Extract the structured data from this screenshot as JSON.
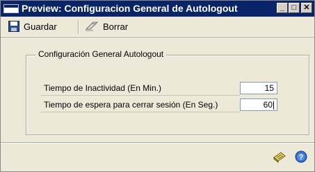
{
  "window": {
    "title": "Preview: Configuracion General de Autologout",
    "controls": {
      "minimize": "_",
      "maximize": "□",
      "close": "✕"
    }
  },
  "toolbar": {
    "save_label": "Guardar",
    "delete_label": "Borrar"
  },
  "group": {
    "legend": "Configuración General Autologout",
    "rows": [
      {
        "label": "Tiempo de Inactividad (En Min.)",
        "value": "15"
      },
      {
        "label": "Tiempo de espera para cerrar sesión (En Seg.)",
        "value": "60"
      }
    ]
  },
  "status": {
    "icons": [
      "notes-icon",
      "help-icon"
    ]
  }
}
